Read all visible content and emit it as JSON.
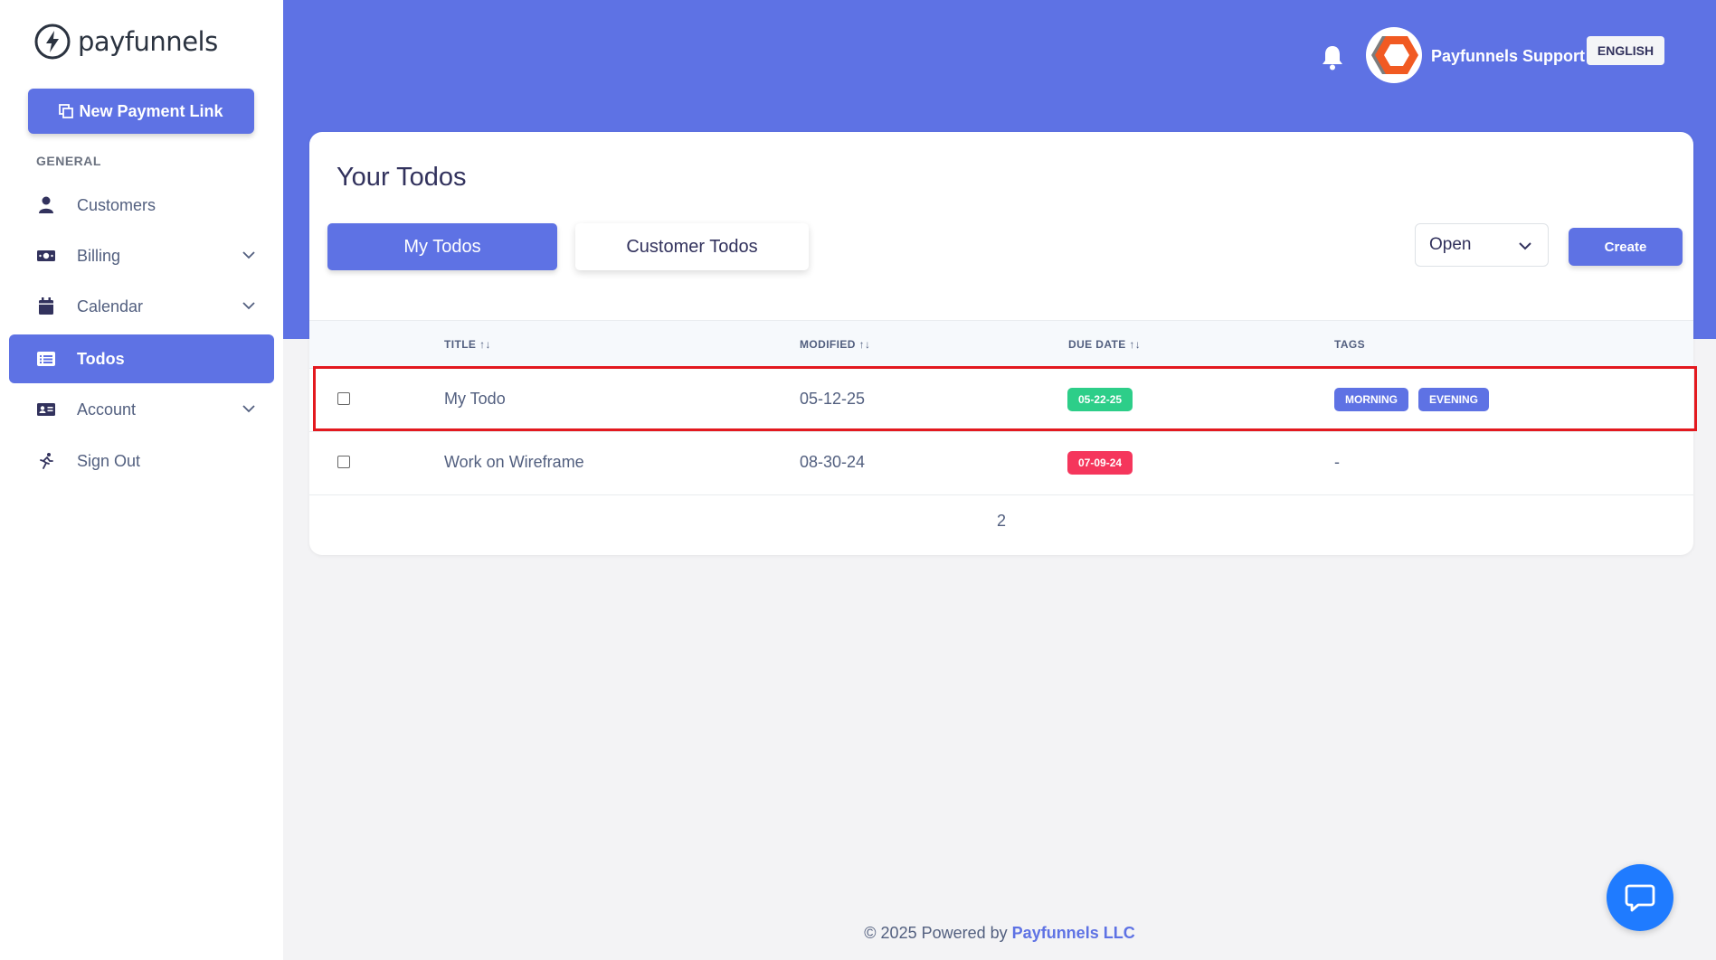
{
  "brand": {
    "logo_text": "payfunnels"
  },
  "sidebar": {
    "new_payment_link": "New Payment Link",
    "section_label": "GENERAL",
    "items": [
      {
        "label": "Customers",
        "icon": "user-icon",
        "has_chevron": false,
        "active": false
      },
      {
        "label": "Billing",
        "icon": "money-bill-icon",
        "has_chevron": true,
        "active": false
      },
      {
        "label": "Calendar",
        "icon": "calendar-icon",
        "has_chevron": true,
        "active": false
      },
      {
        "label": "Todos",
        "icon": "list-icon",
        "has_chevron": false,
        "active": true
      },
      {
        "label": "Account",
        "icon": "id-card-icon",
        "has_chevron": true,
        "active": false
      },
      {
        "label": "Sign Out",
        "icon": "running-icon",
        "has_chevron": false,
        "active": false
      }
    ]
  },
  "header": {
    "user_name": "Payfunnels Support",
    "language": "ENGLISH"
  },
  "main": {
    "title": "Your Todos",
    "tabs": [
      {
        "label": "My Todos",
        "active": true
      },
      {
        "label": "Customer Todos",
        "active": false
      }
    ],
    "status_filter": "Open",
    "create_label": "Create",
    "columns": [
      "TITLE",
      "MODIFIED",
      "DUE DATE",
      "TAGS"
    ],
    "rows": [
      {
        "title": "My Todo",
        "modified": "05-12-25",
        "due": "05-22-25",
        "due_color": "#2dce89",
        "tags": [
          "MORNING",
          "EVENING"
        ],
        "highlighted": true
      },
      {
        "title": "Work on Wireframe",
        "modified": "08-30-24",
        "due": "07-09-24",
        "due_color": "#f5365c",
        "tags": [],
        "tags_empty": "-"
      }
    ],
    "page": "2"
  },
  "footer": {
    "prefix": "© 2025 Powered by",
    "brand": "Payfunnels LLC"
  },
  "colors": {
    "primary": "#5e72e4",
    "success": "#2dce89",
    "danger": "#f5365c",
    "highlight": "#e3191f"
  }
}
